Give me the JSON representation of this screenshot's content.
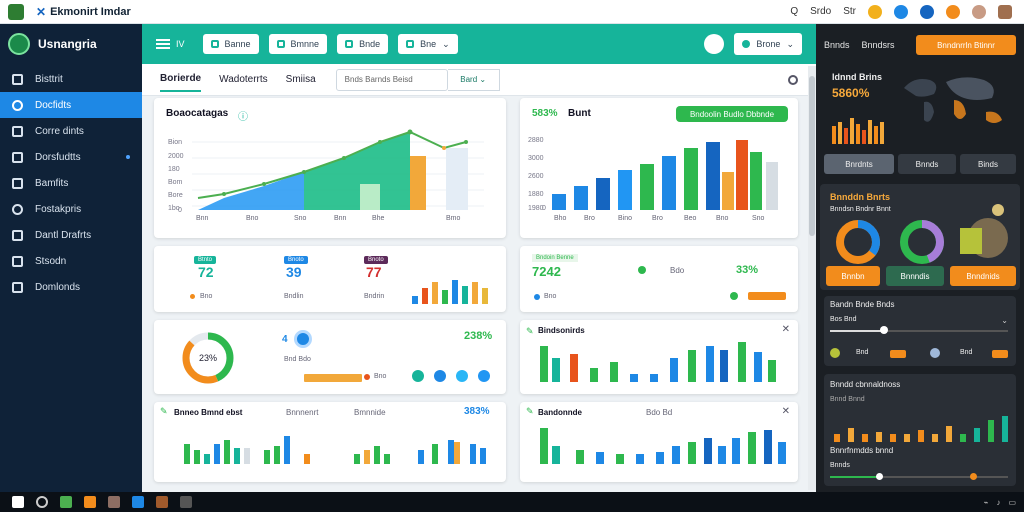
{
  "window": {
    "title": "Ekmonirt Imdar",
    "right_items": [
      "Q",
      "Srdo",
      "Str"
    ]
  },
  "sidebar": {
    "brand": "Usnangria",
    "items": [
      {
        "label": "Bisttrit",
        "active": false,
        "dot": false
      },
      {
        "label": "Docfidts",
        "active": true,
        "dot": false
      },
      {
        "label": "Corre dints",
        "active": false,
        "dot": false
      },
      {
        "label": "Dorsfudtts",
        "active": false,
        "dot": true
      },
      {
        "label": "Bamfits",
        "active": false,
        "dot": false
      },
      {
        "label": "Fostakpris",
        "active": false,
        "dot": false
      },
      {
        "label": "Dantl Drafrts",
        "active": false,
        "dot": false
      },
      {
        "label": "Stsodn",
        "active": false,
        "dot": false
      },
      {
        "label": "Domlonds",
        "active": false,
        "dot": false
      }
    ]
  },
  "toolbar": {
    "iv": "IV",
    "buttons": [
      "Banne",
      "Bmnne",
      "Bnde",
      "Bne"
    ],
    "dropdown": "Brone"
  },
  "subtabs": {
    "tabs": [
      "Borierde",
      "Wadoterrts",
      "Smiisa"
    ],
    "filter": "Bnds Barnds Beisd",
    "filter_drop": "Bard"
  },
  "card1": {
    "title": "Boaocatagas",
    "yticks": [
      "Bion",
      "2000",
      "180",
      "Bom",
      "Bore",
      "1bo",
      "0"
    ],
    "xticks": [
      "Bnn",
      "Bno",
      "Sno",
      "Bnn",
      "Bhe",
      "Bmo"
    ]
  },
  "card2": {
    "stat": "583%",
    "label": "Bunt",
    "pill": "Bndoolin Budlo Dbbnde",
    "yticks": [
      "2880",
      "3000",
      "2600",
      "1880",
      "1980",
      "0"
    ],
    "xticks": [
      "Bho",
      "Bro",
      "Bino",
      "Bro",
      "Beo",
      "Bno",
      "Sno"
    ]
  },
  "card3": {
    "kpis": [
      {
        "value": "72",
        "tag": "Btnto",
        "sub": "Bno"
      },
      {
        "value": "39",
        "tag": "Bnoto",
        "sub": "Bndlin"
      },
      {
        "value": "77",
        "tag": "Bnoto",
        "sub": "Bndrin"
      }
    ]
  },
  "card4": {
    "value": "7242",
    "tag": "Bndoin Benne",
    "mid": "Bdo",
    "pct": "33%",
    "sub": "Bno"
  },
  "card5": {
    "donut_value": "23%",
    "mid_value": "4",
    "mid_label": "Bnd Bdo",
    "pct": "238%",
    "sub": "Bno"
  },
  "card6": {
    "title": "Bindsonirds"
  },
  "card7": {
    "title": "Bnneo Bmnd ebst",
    "mid": "Bnnnenrt",
    "right": "Bmnnide",
    "pct": "383%"
  },
  "card8": {
    "title": "Bandonnde",
    "mid": "Bdo Bd"
  },
  "rpanel": {
    "head": [
      "Bnnds",
      "Bnndsrs"
    ],
    "orange_btn": "Bnndnrrln Btinnr",
    "map_title": "Idnnd Brins",
    "map_stat": "5860%",
    "tabs": [
      "Bnrdnts",
      "Bnnds",
      "Binds"
    ],
    "donut_title": "Bnnddn Bnrts",
    "donut_sub": "Bnndsn Bndnr Bnnt",
    "donut_btns": [
      "Bnnbn",
      "Bnnndis",
      "Bnndnids"
    ],
    "slider_title": "Bandn Bnde Bnds",
    "slider_sub": "Bos Bnd",
    "slider_items": [
      "Bnd",
      "Bnd",
      "Bnd"
    ],
    "bars_title": "Bnndd cbnnaldnoss",
    "bars_sub": "Bnnd Bnnd",
    "footer_title": "Bnnrfnmdds bnnd",
    "footer_sub": "Bnnds"
  },
  "colors": {
    "teal": "#16b49a",
    "navy": "#0f2238",
    "blue": "#1e88e5",
    "green": "#2eb84e",
    "orange": "#f28c1c"
  }
}
